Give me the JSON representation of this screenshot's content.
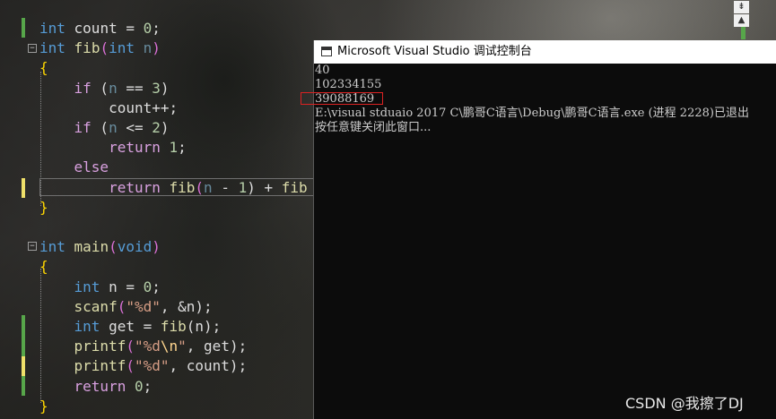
{
  "editor": {
    "lines": [
      [
        {
          "t": "int",
          "c": "kw"
        },
        {
          "t": " count = ",
          "c": ""
        },
        {
          "t": "0",
          "c": "num"
        },
        {
          "t": ";",
          "c": ""
        }
      ],
      [
        {
          "t": "int",
          "c": "kw"
        },
        {
          "t": " ",
          "c": ""
        },
        {
          "t": "fib",
          "c": "fn"
        },
        {
          "t": "(",
          "c": "paren"
        },
        {
          "t": "int",
          "c": "kw"
        },
        {
          "t": " ",
          "c": ""
        },
        {
          "t": "n",
          "c": "par"
        },
        {
          "t": ")",
          "c": "paren"
        }
      ],
      [
        {
          "t": "{",
          "c": "brace"
        }
      ],
      [
        {
          "t": "    ",
          "c": ""
        },
        {
          "t": "if",
          "c": "ctrl"
        },
        {
          "t": " (",
          "c": ""
        },
        {
          "t": "n",
          "c": "par"
        },
        {
          "t": " == ",
          "c": ""
        },
        {
          "t": "3",
          "c": "num"
        },
        {
          "t": ")",
          "c": ""
        }
      ],
      [
        {
          "t": "        count++;",
          "c": ""
        }
      ],
      [
        {
          "t": "    ",
          "c": ""
        },
        {
          "t": "if",
          "c": "ctrl"
        },
        {
          "t": " (",
          "c": ""
        },
        {
          "t": "n",
          "c": "par"
        },
        {
          "t": " <= ",
          "c": ""
        },
        {
          "t": "2",
          "c": "num"
        },
        {
          "t": ")",
          "c": ""
        }
      ],
      [
        {
          "t": "        ",
          "c": ""
        },
        {
          "t": "return",
          "c": "ctrl"
        },
        {
          "t": " ",
          "c": ""
        },
        {
          "t": "1",
          "c": "num"
        },
        {
          "t": ";",
          "c": ""
        }
      ],
      [
        {
          "t": "    ",
          "c": ""
        },
        {
          "t": "else",
          "c": "ctrl"
        }
      ],
      [
        {
          "t": "        ",
          "c": ""
        },
        {
          "t": "return",
          "c": "ctrl"
        },
        {
          "t": " ",
          "c": ""
        },
        {
          "t": "fib",
          "c": "fn"
        },
        {
          "t": "(",
          "c": "paren"
        },
        {
          "t": "n",
          "c": "par"
        },
        {
          "t": " - ",
          "c": ""
        },
        {
          "t": "1",
          "c": "num"
        },
        {
          "t": ") + ",
          "c": ""
        },
        {
          "t": "fib",
          "c": "fn"
        }
      ],
      [
        {
          "t": "}",
          "c": "brace"
        }
      ],
      [
        {
          "t": "",
          "c": ""
        }
      ],
      [
        {
          "t": "int",
          "c": "kw"
        },
        {
          "t": " ",
          "c": ""
        },
        {
          "t": "main",
          "c": "fn"
        },
        {
          "t": "(",
          "c": "paren"
        },
        {
          "t": "void",
          "c": "kw"
        },
        {
          "t": ")",
          "c": "paren"
        }
      ],
      [
        {
          "t": "{",
          "c": "brace"
        }
      ],
      [
        {
          "t": "    ",
          "c": ""
        },
        {
          "t": "int",
          "c": "kw"
        },
        {
          "t": " n = ",
          "c": ""
        },
        {
          "t": "0",
          "c": "num"
        },
        {
          "t": ";",
          "c": ""
        }
      ],
      [
        {
          "t": "    ",
          "c": ""
        },
        {
          "t": "scanf",
          "c": "fn"
        },
        {
          "t": "(",
          "c": "paren"
        },
        {
          "t": "\"%d\"",
          "c": "str"
        },
        {
          "t": ", &n);",
          "c": ""
        }
      ],
      [
        {
          "t": "    ",
          "c": ""
        },
        {
          "t": "int",
          "c": "kw"
        },
        {
          "t": " get = ",
          "c": ""
        },
        {
          "t": "fib",
          "c": "fn"
        },
        {
          "t": "(n);",
          "c": ""
        }
      ],
      [
        {
          "t": "    ",
          "c": ""
        },
        {
          "t": "printf",
          "c": "fn"
        },
        {
          "t": "(",
          "c": "paren"
        },
        {
          "t": "\"%d",
          "c": "str"
        },
        {
          "t": "\\n",
          "c": "esc"
        },
        {
          "t": "\"",
          "c": "str"
        },
        {
          "t": ", get);",
          "c": ""
        }
      ],
      [
        {
          "t": "    ",
          "c": ""
        },
        {
          "t": "printf",
          "c": "fn"
        },
        {
          "t": "(",
          "c": "paren"
        },
        {
          "t": "\"%d\"",
          "c": "str"
        },
        {
          "t": ", count);",
          "c": ""
        }
      ],
      [
        {
          "t": "    ",
          "c": ""
        },
        {
          "t": "return",
          "c": "ctrl"
        },
        {
          "t": " ",
          "c": ""
        },
        {
          "t": "0",
          "c": "num"
        },
        {
          "t": ";",
          "c": ""
        }
      ],
      [
        {
          "t": "}",
          "c": "brace"
        }
      ]
    ]
  },
  "scroll_buttons": {
    "top": "⇟",
    "up": "▲"
  },
  "console": {
    "title": "Microsoft Visual Studio 调试控制台",
    "output": [
      "40",
      "102334155",
      "39088169",
      "E:\\visual stduaio 2017 C\\鹏哥C语言\\Debug\\鹏哥C语言.exe (进程 2228)已退出",
      "按任意键关闭此窗口..."
    ]
  },
  "watermark": "CSDN @我擦了DJ",
  "colors": {
    "keyword": "#569cd6",
    "control": "#d8a0df",
    "function": "#dcdcaa",
    "string": "#d69d85",
    "number": "#b5cea8",
    "console_bg": "#0c0c0c",
    "highlight_box": "#dd2222"
  }
}
